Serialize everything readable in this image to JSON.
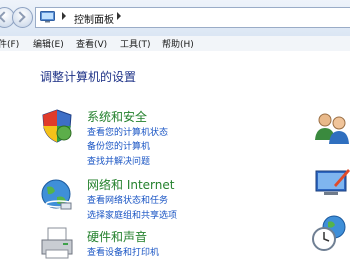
{
  "address_bar": {
    "breadcrumb": "控制面板",
    "location_icon": "control-panel-icon"
  },
  "menu": {
    "items": [
      "件(F)",
      "编辑(E)",
      "查看(V)",
      "工具(T)",
      "帮助(H)"
    ]
  },
  "page": {
    "title": "调整计算机的设置"
  },
  "categories": [
    {
      "title": "系统和安全",
      "icon": "shield-icon",
      "links": [
        "查看您的计算机状态",
        "备份您的计算机",
        "查找并解决问题"
      ]
    },
    {
      "title": "网络和 Internet",
      "icon": "network-globe-icon",
      "links": [
        "查看网络状态和任务",
        "选择家庭组和共享选项"
      ]
    },
    {
      "title": "硬件和声音",
      "icon": "printer-icon",
      "links": [
        "查看设备和打印机"
      ]
    }
  ],
  "right_column_icons": [
    "user-accounts-icon",
    "appearance-icon",
    "clock-globe-icon"
  ],
  "colors": {
    "category_title": "#24812d",
    "link": "#1a55c4",
    "page_title": "#1e3287"
  }
}
